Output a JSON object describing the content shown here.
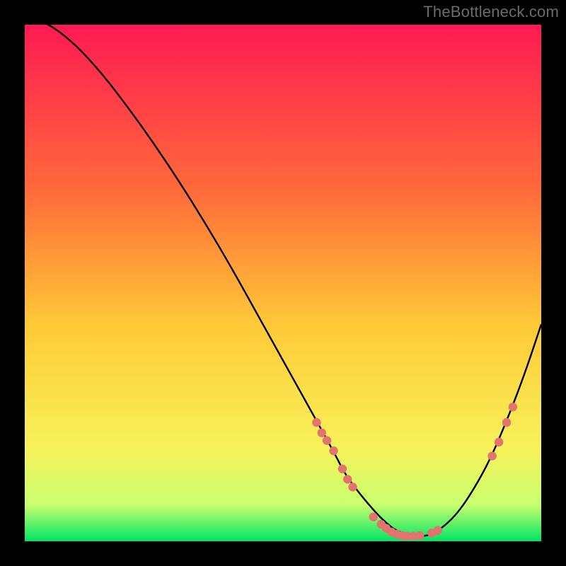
{
  "attribution": "TheBottleneck.com",
  "colors": {
    "background": "#000000",
    "gradient_top": "#ff1a52",
    "gradient_mid1": "#ff6a3a",
    "gradient_mid2": "#ffc937",
    "gradient_mid3": "#f7f25a",
    "gradient_mid4": "#c8ff6f",
    "gradient_bottom": "#00e564",
    "curve": "#000000",
    "marker": "#e2736e",
    "attribution_text": "#6b6b6b"
  },
  "chart_data": {
    "type": "line",
    "title": "",
    "xlabel": "",
    "ylabel": "",
    "xlim": [
      0,
      100
    ],
    "ylim": [
      0,
      100
    ],
    "series": [
      {
        "name": "bottleneck-curve",
        "x": [
          0,
          5,
          10,
          15,
          20,
          25,
          30,
          35,
          40,
          45,
          50,
          55,
          60,
          62,
          65,
          68,
          70,
          72,
          75,
          78,
          80,
          83,
          86,
          90,
          94,
          97,
          100
        ],
        "y": [
          102,
          100,
          96,
          90.5,
          84,
          77,
          69.5,
          61.5,
          53,
          44,
          35,
          26,
          17,
          13,
          9,
          5.5,
          3.5,
          2,
          1,
          1,
          2,
          4.5,
          8.5,
          15.5,
          25,
          33,
          42
        ]
      }
    ],
    "markers": [
      {
        "x": 56.5,
        "y": 23.0
      },
      {
        "x": 57.5,
        "y": 21.0
      },
      {
        "x": 58.5,
        "y": 19.5
      },
      {
        "x": 59.8,
        "y": 17.5
      },
      {
        "x": 61.5,
        "y": 14.0
      },
      {
        "x": 62.5,
        "y": 12.0
      },
      {
        "x": 63.5,
        "y": 10.5
      },
      {
        "x": 67.5,
        "y": 4.7
      },
      {
        "x": 69.0,
        "y": 3.3
      },
      {
        "x": 70.0,
        "y": 2.5
      },
      {
        "x": 71.0,
        "y": 1.8
      },
      {
        "x": 72.0,
        "y": 1.4
      },
      {
        "x": 73.0,
        "y": 1.1
      },
      {
        "x": 74.0,
        "y": 1.0
      },
      {
        "x": 75.2,
        "y": 1.0
      },
      {
        "x": 76.5,
        "y": 1.1
      },
      {
        "x": 78.8,
        "y": 1.6
      },
      {
        "x": 80.0,
        "y": 2.1
      },
      {
        "x": 90.5,
        "y": 16.5
      },
      {
        "x": 91.8,
        "y": 19.2
      },
      {
        "x": 93.3,
        "y": 23.0
      },
      {
        "x": 94.5,
        "y": 26.0
      }
    ]
  }
}
